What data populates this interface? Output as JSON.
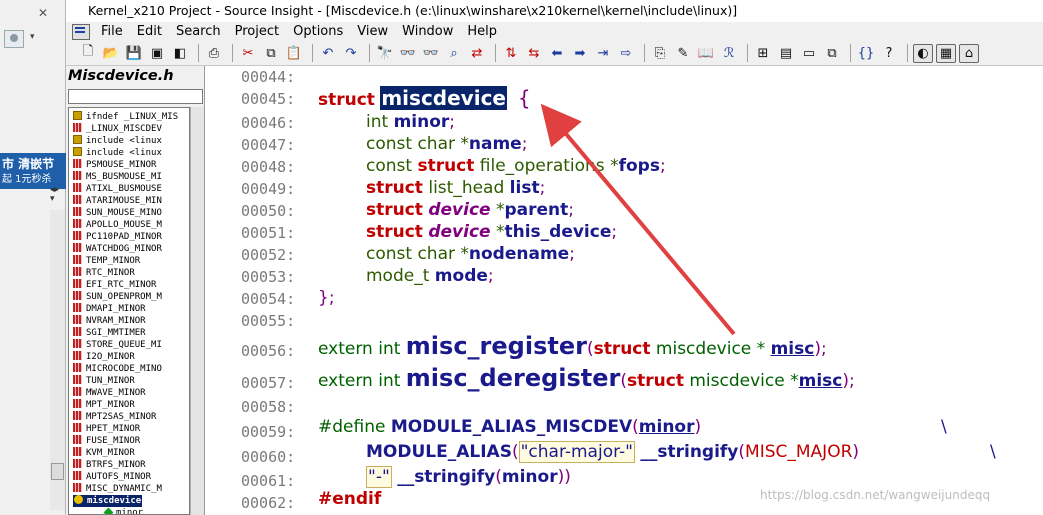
{
  "window": {
    "title": "Kernel_x210 Project - Source Insight - [Miscdevice.h (e:\\linux\\winshare\\x210kernel\\kernel\\include\\linux)]"
  },
  "left_strip": {
    "ad_line1": "市 清嵌节",
    "ad_line2": "起 1元秒杀"
  },
  "menu": {
    "items": [
      "File",
      "Edit",
      "Search",
      "Project",
      "Options",
      "View",
      "Window",
      "Help"
    ]
  },
  "symbol_panel": {
    "title": "Miscdevice.h",
    "search_value": "",
    "items": [
      {
        "label": "ifndef _LINUX_MIS",
        "icon": "directive-icon"
      },
      {
        "label": "_LINUX_MISCDEV",
        "icon": "define-icon"
      },
      {
        "label": "include <linux",
        "icon": "include-icon"
      },
      {
        "label": "include <linux",
        "icon": "include-icon"
      },
      {
        "label": "PSMOUSE_MINOR",
        "icon": "define-icon"
      },
      {
        "label": "MS_BUSMOUSE_MI",
        "icon": "define-icon"
      },
      {
        "label": "ATIXL_BUSMOUSE",
        "icon": "define-icon"
      },
      {
        "label": "ATARIMOUSE_MIN",
        "icon": "define-icon"
      },
      {
        "label": "SUN_MOUSE_MINO",
        "icon": "define-icon"
      },
      {
        "label": "APOLLO_MOUSE_M",
        "icon": "define-icon"
      },
      {
        "label": "PC110PAD_MINOR",
        "icon": "define-icon"
      },
      {
        "label": "WATCHDOG_MINOR",
        "icon": "define-icon"
      },
      {
        "label": "TEMP_MINOR",
        "icon": "define-icon"
      },
      {
        "label": "RTC_MINOR",
        "icon": "define-icon"
      },
      {
        "label": "EFI_RTC_MINOR",
        "icon": "define-icon"
      },
      {
        "label": "SUN_OPENPROM_M",
        "icon": "define-icon"
      },
      {
        "label": "DMAPI_MINOR",
        "icon": "define-icon"
      },
      {
        "label": "NVRAM_MINOR",
        "icon": "define-icon"
      },
      {
        "label": "SGI_MMTIMER",
        "icon": "define-icon"
      },
      {
        "label": "STORE_QUEUE_MI",
        "icon": "define-icon"
      },
      {
        "label": "I2O_MINOR",
        "icon": "define-icon"
      },
      {
        "label": "MICROCODE_MINO",
        "icon": "define-icon"
      },
      {
        "label": "TUN_MINOR",
        "icon": "define-icon"
      },
      {
        "label": "MWAVE_MINOR",
        "icon": "define-icon"
      },
      {
        "label": "MPT_MINOR",
        "icon": "define-icon"
      },
      {
        "label": "MPT2SAS_MINOR",
        "icon": "define-icon"
      },
      {
        "label": "HPET_MINOR",
        "icon": "define-icon"
      },
      {
        "label": "FUSE_MINOR",
        "icon": "define-icon"
      },
      {
        "label": "KVM_MINOR",
        "icon": "define-icon"
      },
      {
        "label": "BTRFS_MINOR",
        "icon": "define-icon"
      },
      {
        "label": "AUTOFS_MINOR",
        "icon": "define-icon"
      },
      {
        "label": "MISC_DYNAMIC_M",
        "icon": "define-icon"
      },
      {
        "label": "miscdevice",
        "icon": "struct-icon",
        "selected": true
      },
      {
        "label": "minor",
        "icon": "field-icon"
      }
    ]
  },
  "editor": {
    "line_numbers": [
      "00044:",
      "00045:",
      "00046:",
      "00047:",
      "00048:",
      "00049:",
      "00050:",
      "00051:",
      "00052:",
      "00053:",
      "00054:",
      "00055:",
      "00056:",
      "00057:",
      "00058:",
      "00059:",
      "00060:",
      "00061:",
      "00062:"
    ],
    "kw_struct": "struct",
    "kw_device": "device",
    "kw_extern": "extern",
    "kw_endif": "#endif",
    "kw_define": "#define",
    "t_int": "int",
    "t_const_char": "const char",
    "t_list_head": "list_head",
    "t_mode_t": "mode_t",
    "struct_name": "miscdevice",
    "open_brace": "{",
    "close_brace": "};",
    "f_minor": "minor",
    "f_name": "name",
    "t_file_ops": "file_operations",
    "f_fops": "fops",
    "f_list": "list",
    "f_parent": "parent",
    "f_this_device": "this_device",
    "f_nodename": "nodename",
    "f_mode": "mode",
    "fn_register": "misc_register",
    "fn_deregister": "misc_deregister",
    "arg_type": "miscdevice",
    "arg_misc": "misc",
    "macro_alias_miscdev": "MODULE_ALIAS_MISCDEV",
    "macro_alias": "MODULE_ALIAS",
    "str_char_major": "\"char-major-\"",
    "macro_stringify": "__stringify",
    "misc_major": "MISC_MAJOR",
    "str_dash": "\"-\"",
    "backslash": "\\"
  },
  "watermark": "https://blog.csdn.net/wangweijundeqq",
  "colors": {
    "keyword": "#c00000",
    "identifier": "#1a1a8c",
    "selection": "#0a246a",
    "arrow": "#e04040"
  }
}
